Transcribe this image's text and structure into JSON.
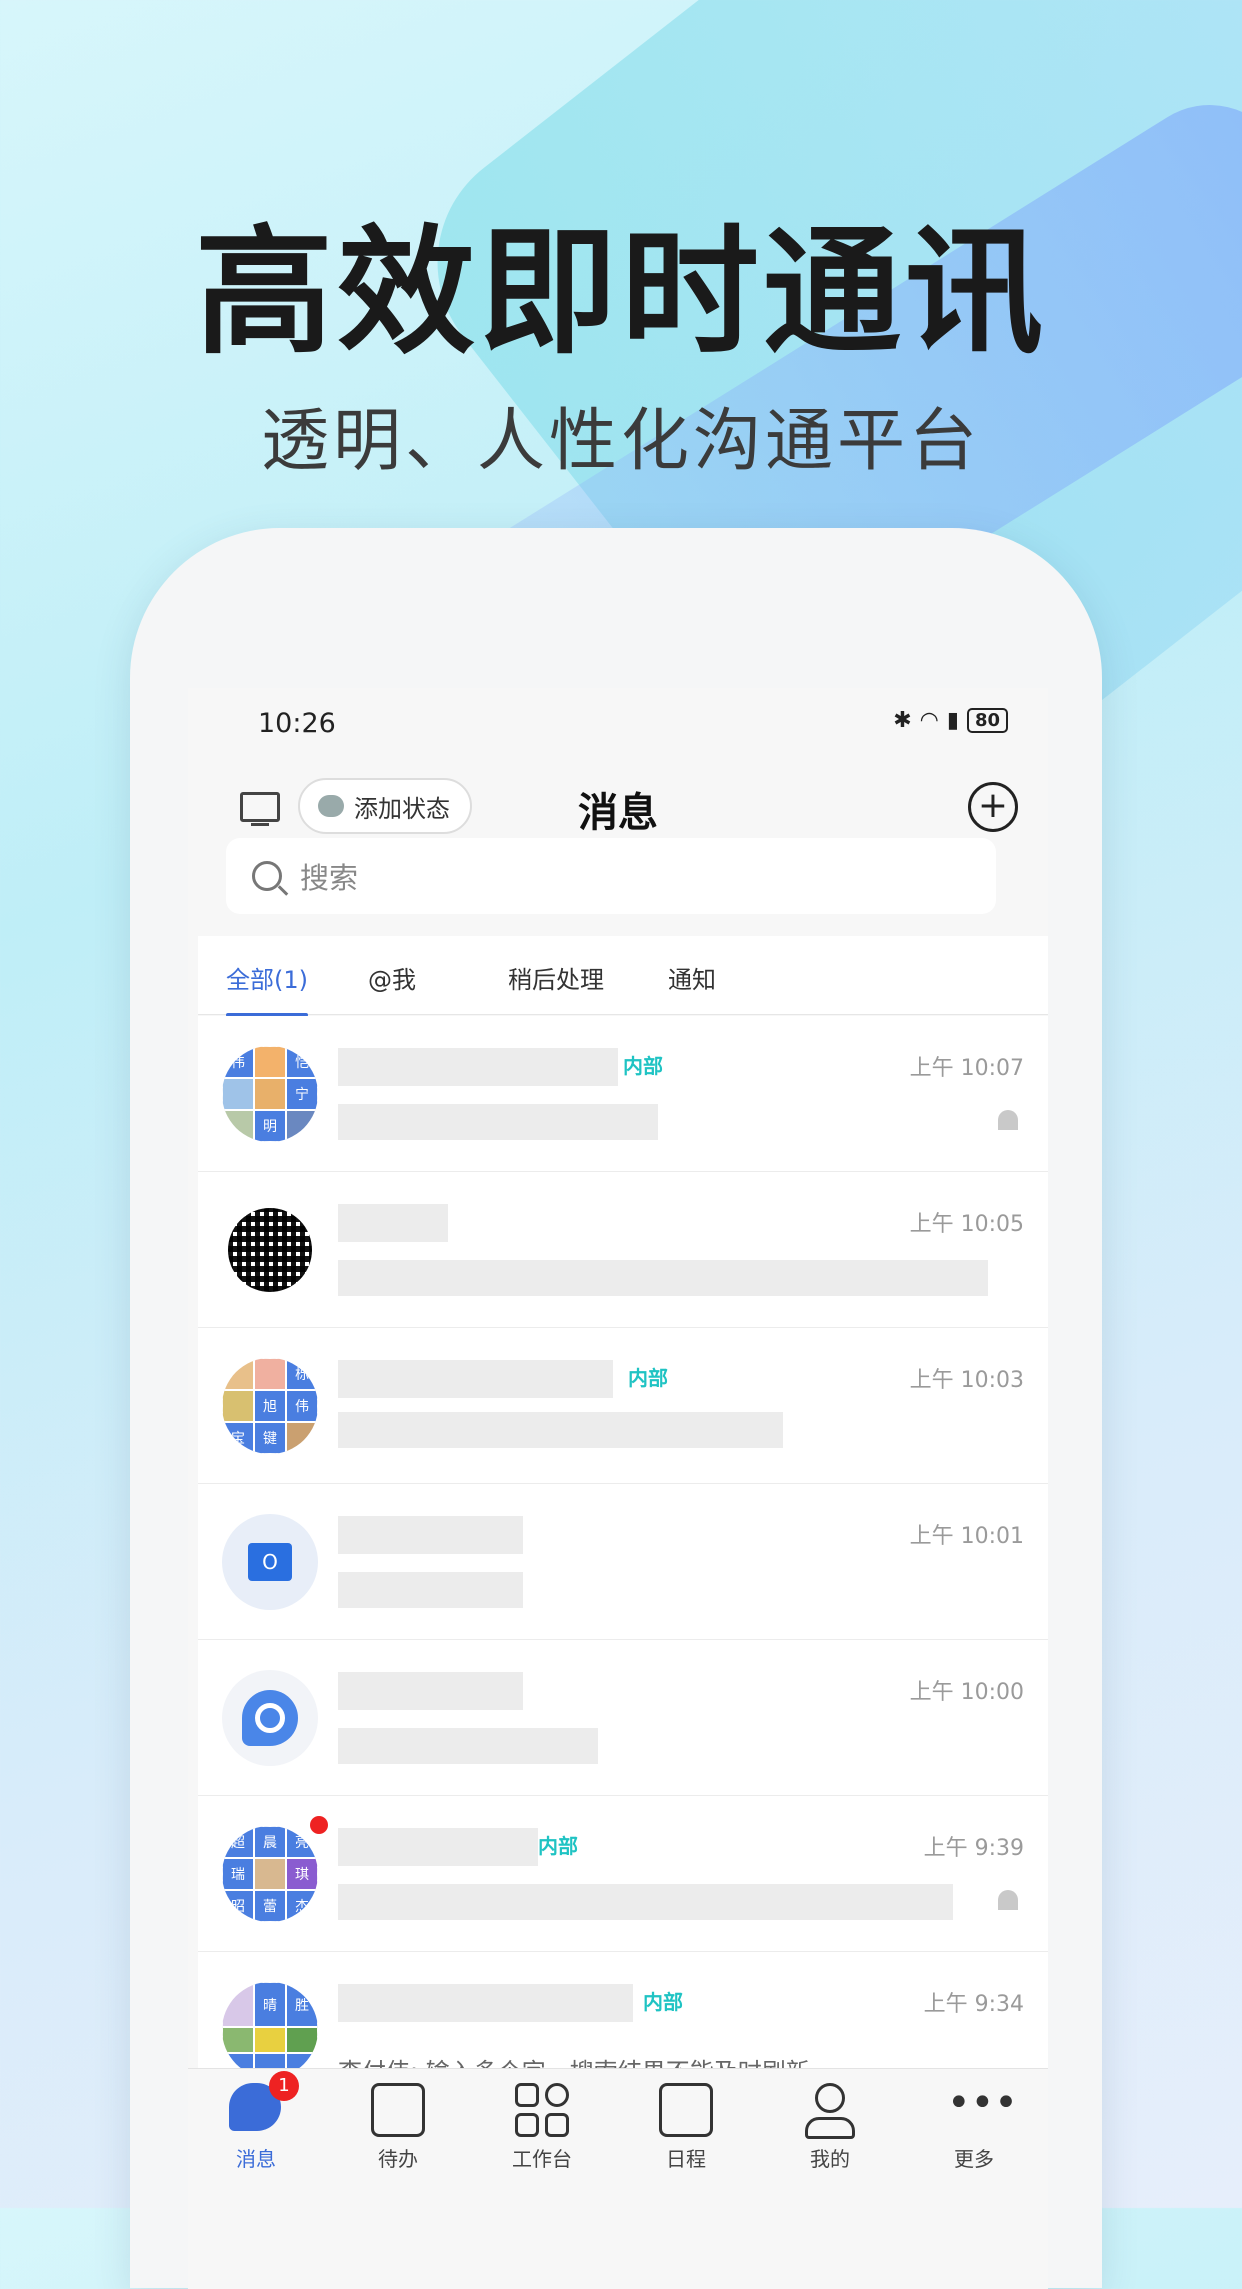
{
  "promo": {
    "headline": "高效即时通讯",
    "subline": "透明、人性化沟通平台"
  },
  "status_bar": {
    "time": "10:26",
    "battery": "80"
  },
  "header": {
    "add_status_label": "添加状态",
    "title": "消息",
    "add_icon": "+"
  },
  "search": {
    "placeholder": "搜索"
  },
  "tabs": [
    {
      "label": "全部(1)",
      "active": true
    },
    {
      "label": "@我"
    },
    {
      "label": "稍后处理"
    },
    {
      "label": "通知"
    }
  ],
  "conversations": [
    {
      "avatar": "group",
      "tag": "内部",
      "time": "上午 10:07",
      "muted": true,
      "avatar_chars": [
        "伟",
        "恺",
        "",
        "",
        "",
        "宁",
        "",
        "明",
        ""
      ]
    },
    {
      "avatar": "qr",
      "tag": "",
      "time": "上午 10:05",
      "muted": false
    },
    {
      "avatar": "group",
      "tag": "内部",
      "time": "上午 10:03",
      "muted": false,
      "avatar_chars": [
        "",
        "",
        "栎",
        "",
        "旭",
        "伟",
        "宝",
        "键",
        ""
      ]
    },
    {
      "avatar": "outlook",
      "tag": "",
      "time": "上午 10:01",
      "muted": false,
      "avatar_chars": [
        "O"
      ]
    },
    {
      "avatar": "camera",
      "tag": "",
      "time": "上午 10:00",
      "muted": false
    },
    {
      "avatar": "group",
      "tag": "内部",
      "time": "上午 9:39",
      "muted": true,
      "unread": true,
      "avatar_chars": [
        "超",
        "晨",
        "亮",
        "瑞",
        "",
        "琪",
        "昭",
        "蕾",
        "杰"
      ]
    },
    {
      "avatar": "group",
      "tag": "内部",
      "time": "上午 9:34",
      "muted": true,
      "preview": "李付伟: 输入多个字，搜索结果不能及时刷新",
      "avatar_chars": [
        "",
        "晴",
        "胜"
      ]
    }
  ],
  "bottom_nav": [
    {
      "label": "消息",
      "icon": "chat-icon",
      "badge": "1",
      "active": true
    },
    {
      "label": "待办",
      "icon": "todo-icon"
    },
    {
      "label": "工作台",
      "icon": "apps-grid-icon"
    },
    {
      "label": "日程",
      "icon": "calendar-icon"
    },
    {
      "label": "我的",
      "icon": "person-icon"
    },
    {
      "label": "更多",
      "icon": "more-icon"
    }
  ],
  "colors": {
    "accent": "#3b6cd8",
    "tag": "#1fc3c3",
    "badge": "#ee2222"
  }
}
